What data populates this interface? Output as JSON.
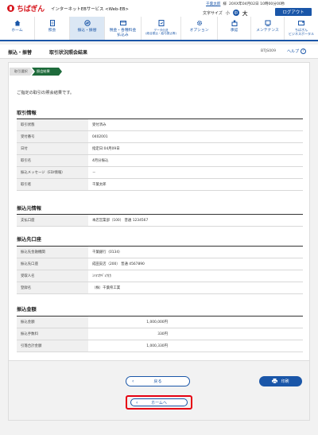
{
  "header": {
    "brand": "ちばぎん",
    "service": "インターネットEBサービス <Web-EB>",
    "user_name": "千葉太郎",
    "user_suffix": "様",
    "last_login": "20XX年04月02日 10時00分00秒",
    "text_size_label": "文字サイズ",
    "size_small": "小",
    "size_medium": "中",
    "size_large": "大",
    "logout": "ログアウト"
  },
  "nav": [
    {
      "label": "ホーム",
      "icon": "home-icon"
    },
    {
      "label": "照会",
      "icon": "document-icon"
    },
    {
      "label": "振込・振替",
      "icon": "transfer-icon"
    },
    {
      "label": "税金・各種料金\n払込み",
      "icon": "tax-icon"
    },
    {
      "label": "データ伝送\n(総合振込・給与振込等)",
      "icon": "data-icon"
    },
    {
      "label": "オプション",
      "icon": "gear-icon"
    },
    {
      "label": "承認",
      "icon": "approve-icon"
    },
    {
      "label": "メンテナンス",
      "icon": "wrench-icon"
    },
    {
      "label": "ちばぎん\nビジネスポータル",
      "icon": "portal-icon"
    }
  ],
  "title": {
    "category": "振込・振替",
    "page": "取引状況照会結果",
    "screen_id": "BTJS009",
    "help": "ヘルプ"
  },
  "steps": [
    "取引選択",
    "照会結果"
  ],
  "message": "ご指定の取引の照会結果です。",
  "sections": {
    "trade_info": {
      "title": "取引情報",
      "rows": [
        {
          "k": "取引状態",
          "v": "受付済み"
        },
        {
          "k": "受付番号",
          "v": "0402001"
        },
        {
          "k": "日付",
          "v": "指定日:04月09日"
        },
        {
          "k": "取引名",
          "v": "4月分振込"
        },
        {
          "k": "振込メッセージ（EDI情報）",
          "v": "－"
        },
        {
          "k": "取引者",
          "v": "千葉太郎"
        }
      ]
    },
    "source": {
      "title": "振込元情報",
      "rows": [
        {
          "k": "支払口座",
          "v": "本店営業部（100） 普通 1234567"
        }
      ]
    },
    "dest": {
      "title": "振込先口座",
      "rows": [
        {
          "k": "振込先金融機関",
          "v": "千葉銀行（0134）"
        },
        {
          "k": "振込先口座",
          "v": "成田支店（200） 普通 4567890"
        },
        {
          "k": "受取人名",
          "v": "ﾐﾊﾏｺｳｷﾞｮｳ(ｶ"
        },
        {
          "k": "登録名",
          "v": "（株）千葉県工業"
        }
      ]
    },
    "amount": {
      "title": "振込金額",
      "rows": [
        {
          "k": "振込金額",
          "v": "1,000,000円"
        },
        {
          "k": "振込手数料",
          "v": "330円"
        },
        {
          "k": "引落合計金額",
          "v": "1,000,330円"
        }
      ]
    }
  },
  "buttons": {
    "back": "戻る",
    "print": "印刷",
    "home": "ホームへ"
  },
  "colors": {
    "brand_red": "#d71920",
    "primary_blue": "#1a56a8",
    "step_green": "#1e6b3b",
    "highlight_red": "#e60012"
  }
}
